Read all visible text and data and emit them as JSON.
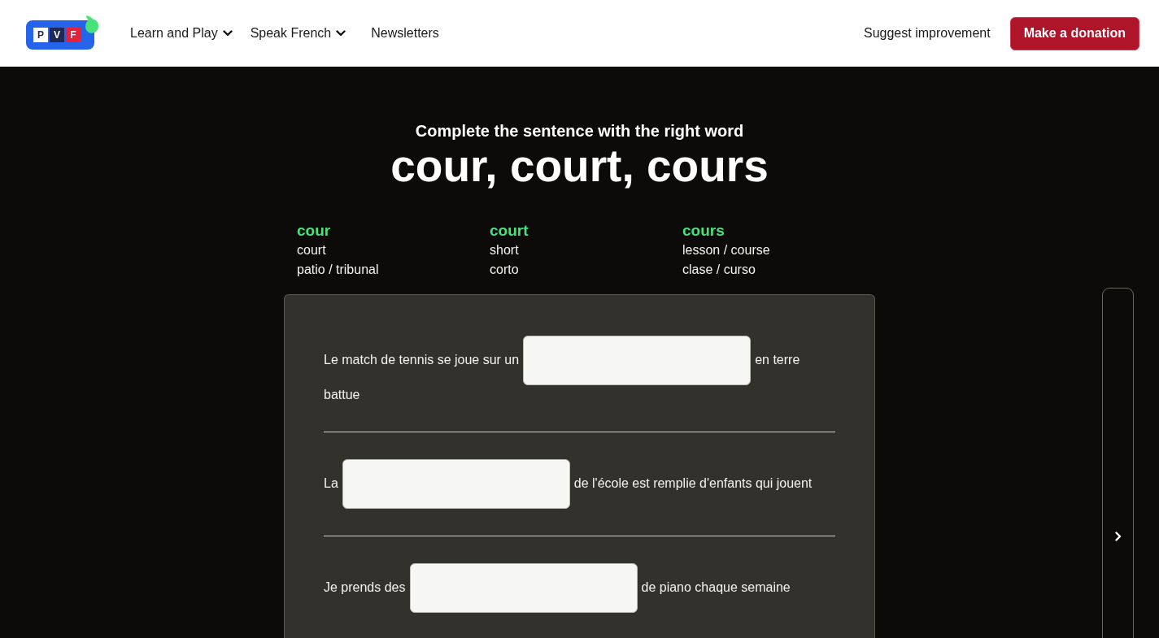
{
  "header": {
    "logo": {
      "letters": [
        "P",
        "V",
        "F"
      ]
    },
    "nav": [
      {
        "label": "Learn and Play",
        "kind": "dropdown"
      },
      {
        "label": "Speak French",
        "kind": "dropdown"
      },
      {
        "label": "Newsletters",
        "kind": "link"
      }
    ],
    "suggest_link": "Suggest improvement",
    "donate_button": "Make a donation"
  },
  "exercise": {
    "instruction": "Complete the sentence with the right word",
    "title": "cour, court, cours",
    "words": [
      {
        "word": "cour",
        "translations": [
          "court",
          "patio / tribunal"
        ]
      },
      {
        "word": "court",
        "translations": [
          "short",
          "corto"
        ]
      },
      {
        "word": "cours",
        "translations": [
          "lesson / course",
          "clase / curso"
        ]
      }
    ],
    "sentences": [
      {
        "before": "Le match de tennis se joue sur un",
        "after": "en terre battue"
      },
      {
        "before": "La",
        "after": "de l'école est remplie d'enfants qui jouent"
      },
      {
        "before": "Je prends des",
        "after": "de piano chaque semaine"
      }
    ]
  }
}
